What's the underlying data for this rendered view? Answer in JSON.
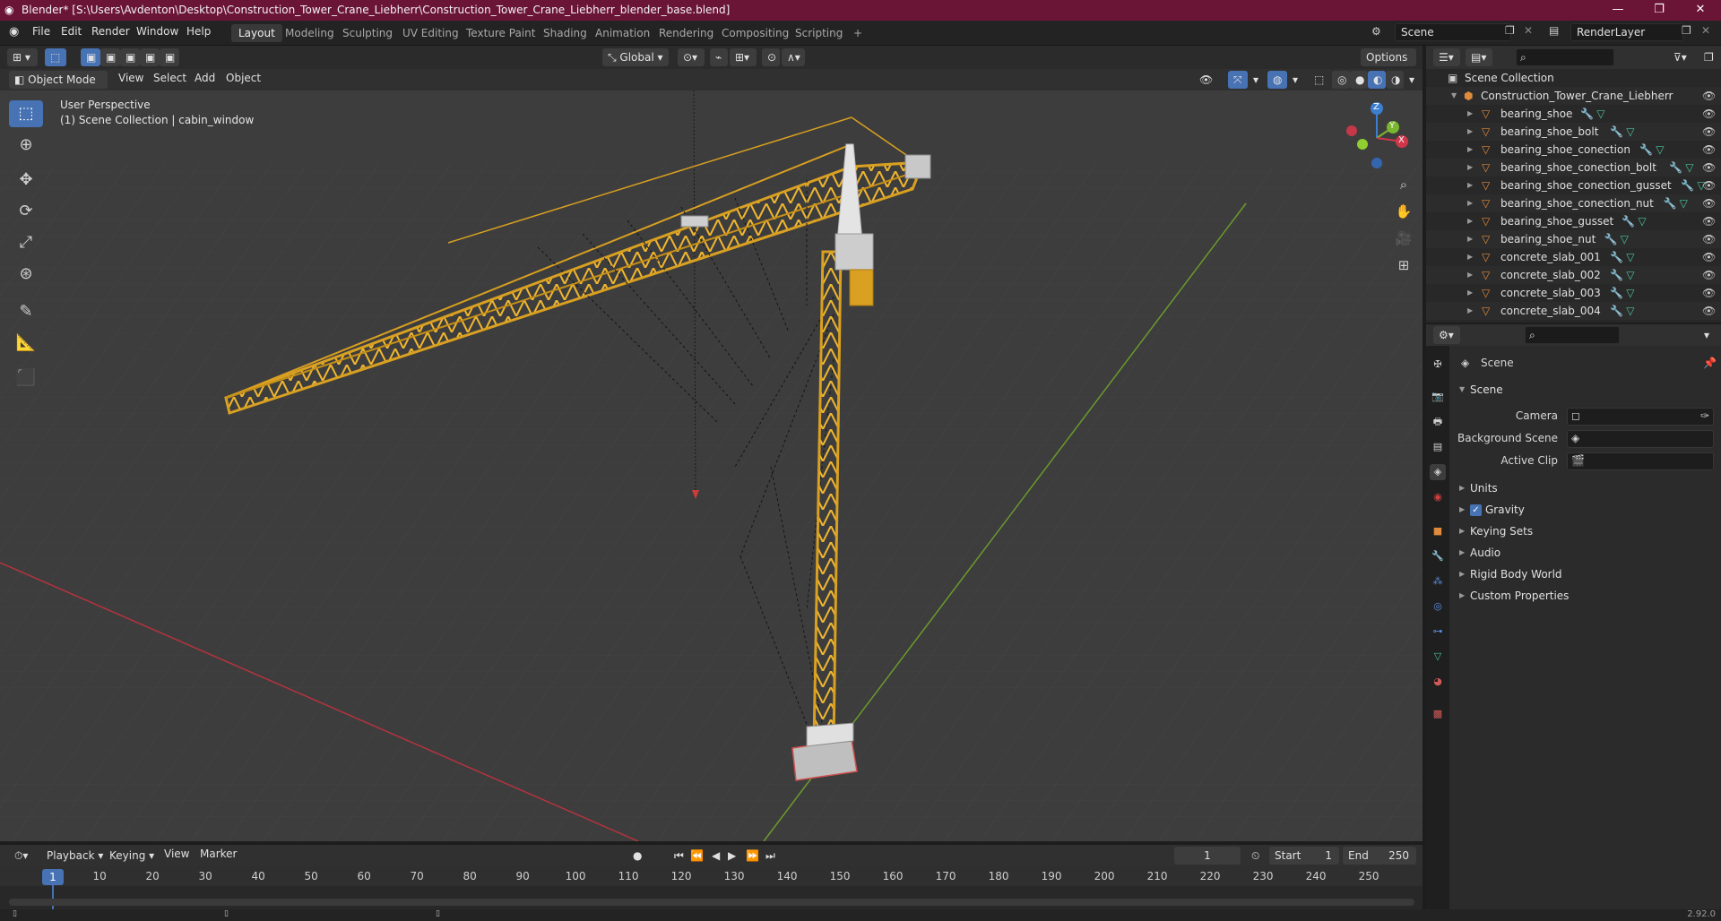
{
  "titlebar": {
    "title": "Blender* [S:\\Users\\Avdenton\\Desktop\\Construction_Tower_Crane_Liebherr\\Construction_Tower_Crane_Liebherr_blender_base.blend]",
    "minimize": "—",
    "maximize": "❐",
    "close": "✕"
  },
  "menubar": {
    "menus": [
      "File",
      "Edit",
      "Render",
      "Window",
      "Help"
    ],
    "workspaces": [
      "Layout",
      "Modeling",
      "Sculpting",
      "UV Editing",
      "Texture Paint",
      "Shading",
      "Animation",
      "Rendering",
      "Compositing",
      "Scripting"
    ],
    "add_workspace": "+",
    "scene": "Scene",
    "view_layer": "RenderLayer"
  },
  "vp_toolbar": {
    "orientation": "Global",
    "options": "Options"
  },
  "vp_header": {
    "mode": "Object Mode",
    "menus": [
      "View",
      "Select",
      "Add",
      "Object"
    ]
  },
  "viewport": {
    "perspective": "User Perspective",
    "collection_info": "(1) Scene Collection | cabin_window",
    "gizmo": {
      "z": "Z",
      "y": "Y",
      "x": "X"
    }
  },
  "timeline": {
    "menus": [
      "Playback",
      "Keying",
      "View",
      "Marker"
    ],
    "current_frame": "1",
    "start_label": "Start",
    "start": "1",
    "end_label": "End",
    "end": "250",
    "ruler": [
      "1",
      "10",
      "20",
      "30",
      "40",
      "50",
      "60",
      "70",
      "80",
      "90",
      "100",
      "110",
      "120",
      "130",
      "140",
      "150",
      "160",
      "170",
      "180",
      "190",
      "200",
      "210",
      "220",
      "230",
      "240",
      "250"
    ]
  },
  "status": {
    "version": "2.92.0"
  },
  "outliner": {
    "root": "Scene Collection",
    "collection": "Construction_Tower_Crane_Liebherr",
    "objects": [
      "bearing_shoe",
      "bearing_shoe_bolt",
      "bearing_shoe_conection",
      "bearing_shoe_conection_bolt",
      "bearing_shoe_conection_gusset",
      "bearing_shoe_conection_nut",
      "bearing_shoe_gusset",
      "bearing_shoe_nut",
      "concrete_slab_001",
      "concrete_slab_002",
      "concrete_slab_003",
      "concrete_slab_004"
    ]
  },
  "properties": {
    "context": "Scene",
    "panel": "Scene",
    "camera_label": "Camera",
    "background_scene_label": "Background Scene",
    "active_clip_label": "Active Clip",
    "subpanels": [
      "Units",
      "Gravity",
      "Keying Sets",
      "Audio",
      "Rigid Body World",
      "Custom Properties"
    ]
  },
  "colors": {
    "titlebar": "#6b1536",
    "accent": "#4772b3",
    "crane": "#d9a021",
    "x_axis": "#b5333f",
    "y_axis": "#6b9a2d"
  }
}
